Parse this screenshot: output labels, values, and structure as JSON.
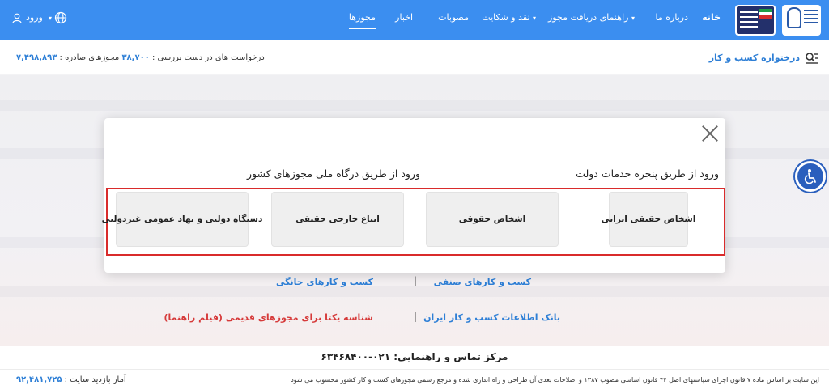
{
  "nav": {
    "home": "خانه",
    "about": "درباره ما",
    "guide": "راهنمای دریافت مجوز",
    "complaint": "نقد و شکایت",
    "approvals": "مصوبات",
    "news": "اخبار",
    "licenses": "مجوزها",
    "login": "ورود"
  },
  "subbar": {
    "title": "درختواره کسب و کار",
    "pending_label": "درخواست های در دست بررسی :",
    "pending_value": "۳۸,۷۰۰",
    "issued_label": "مجوزهای صادره :",
    "issued_value": "۷,۴۹۸,۸۹۳"
  },
  "modal": {
    "gov_title": "ورود از طریق پنجره خدمات دولت",
    "national_title": "ورود از طریق درگاه ملی مجوزهای کشور",
    "options": [
      "اشخاص حقیقی ایرانی",
      "اشخاص حقوقی",
      "اتباع خارجی حقیقی",
      "دستگاه دولتی و نهاد عمومی غیردولتی"
    ]
  },
  "links": {
    "guild": "کسب و کارهای صنفی",
    "home_business": "کسب و کارهای خانگی",
    "bank": "بانک اطلاعات کسب و کار ایران",
    "unique_id": "شناسه یکتا برای مجوزهای قدیمی",
    "film": "(فیلم راهنما)"
  },
  "contact": "مرکز تماس و راهنمایی: ۰۲۱-۶۳۴۶۸۴۰۰",
  "footer": {
    "text": "این سایت بر اساس ماده ۷ قانون اجرای سیاستهای اصل ۴۴ قانون اساسی مصوب ۱۳۸۷ و اصلاحات بعدی آن طراحی و راه اندازی شده و مرجع رسمی مجوزهای کسب و کار کشور محسوب می شود",
    "visits_label": "آمار بازدید سایت :",
    "visits_value": "۹۲,۴۸۱,۷۲۵"
  },
  "icons": [
    "globe-icon",
    "user-icon",
    "tree-search-icon",
    "accessibility-icon",
    "close-icon"
  ],
  "colors": {
    "nav_bg": "#3b8ef0",
    "link_blue": "#2e7fd6",
    "highlight_red": "#d92b2b",
    "access_blue": "#2a5fbd"
  }
}
